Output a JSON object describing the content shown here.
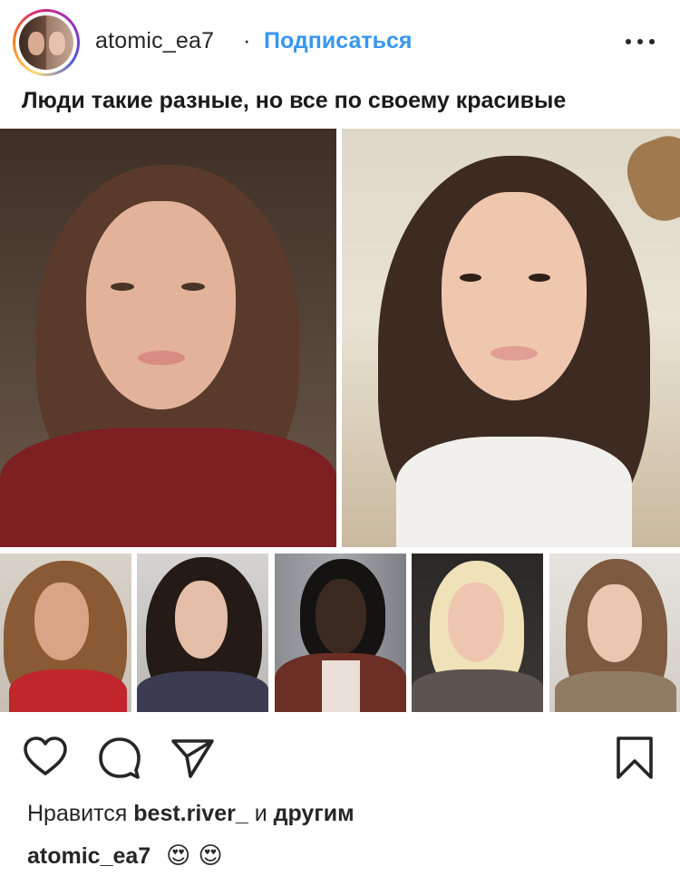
{
  "post": {
    "username": "atomic_ea7",
    "separator": "·",
    "follow_label": "Подписаться",
    "more_icon": "more-horizontal-icon"
  },
  "image": {
    "caption": "Люди такие разные, но все по своему красивые",
    "photos_large": 2,
    "photos_small": 5
  },
  "actions": {
    "like_icon": "heart-icon",
    "comment_icon": "comment-icon",
    "share_icon": "send-icon",
    "save_icon": "bookmark-icon"
  },
  "likes": {
    "prefix": "Нравится",
    "user": "best.river_",
    "conjunction": "и",
    "suffix": "другим"
  },
  "comment": {
    "user": "atomic_ea7",
    "text": "😍 😍"
  },
  "colors": {
    "link": "#3897f0",
    "text": "#262626"
  }
}
